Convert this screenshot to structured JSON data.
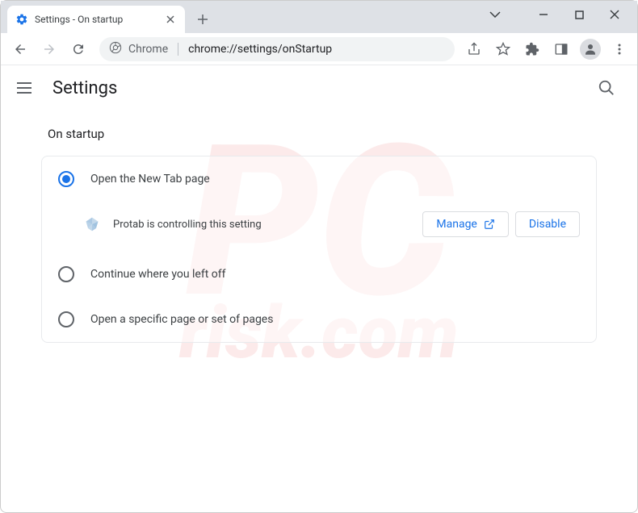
{
  "tab": {
    "title": "Settings - On startup"
  },
  "url": {
    "origin": "Chrome",
    "path": "chrome://settings/onStartup"
  },
  "header": {
    "title": "Settings"
  },
  "section": {
    "title": "On startup"
  },
  "options": [
    {
      "label": "Open the New Tab page",
      "checked": true
    },
    {
      "label": "Continue where you left off",
      "checked": false
    },
    {
      "label": "Open a specific page or set of pages",
      "checked": false
    }
  ],
  "extension": {
    "message": "Protab is controlling this setting",
    "manage": "Manage",
    "disable": "Disable"
  }
}
